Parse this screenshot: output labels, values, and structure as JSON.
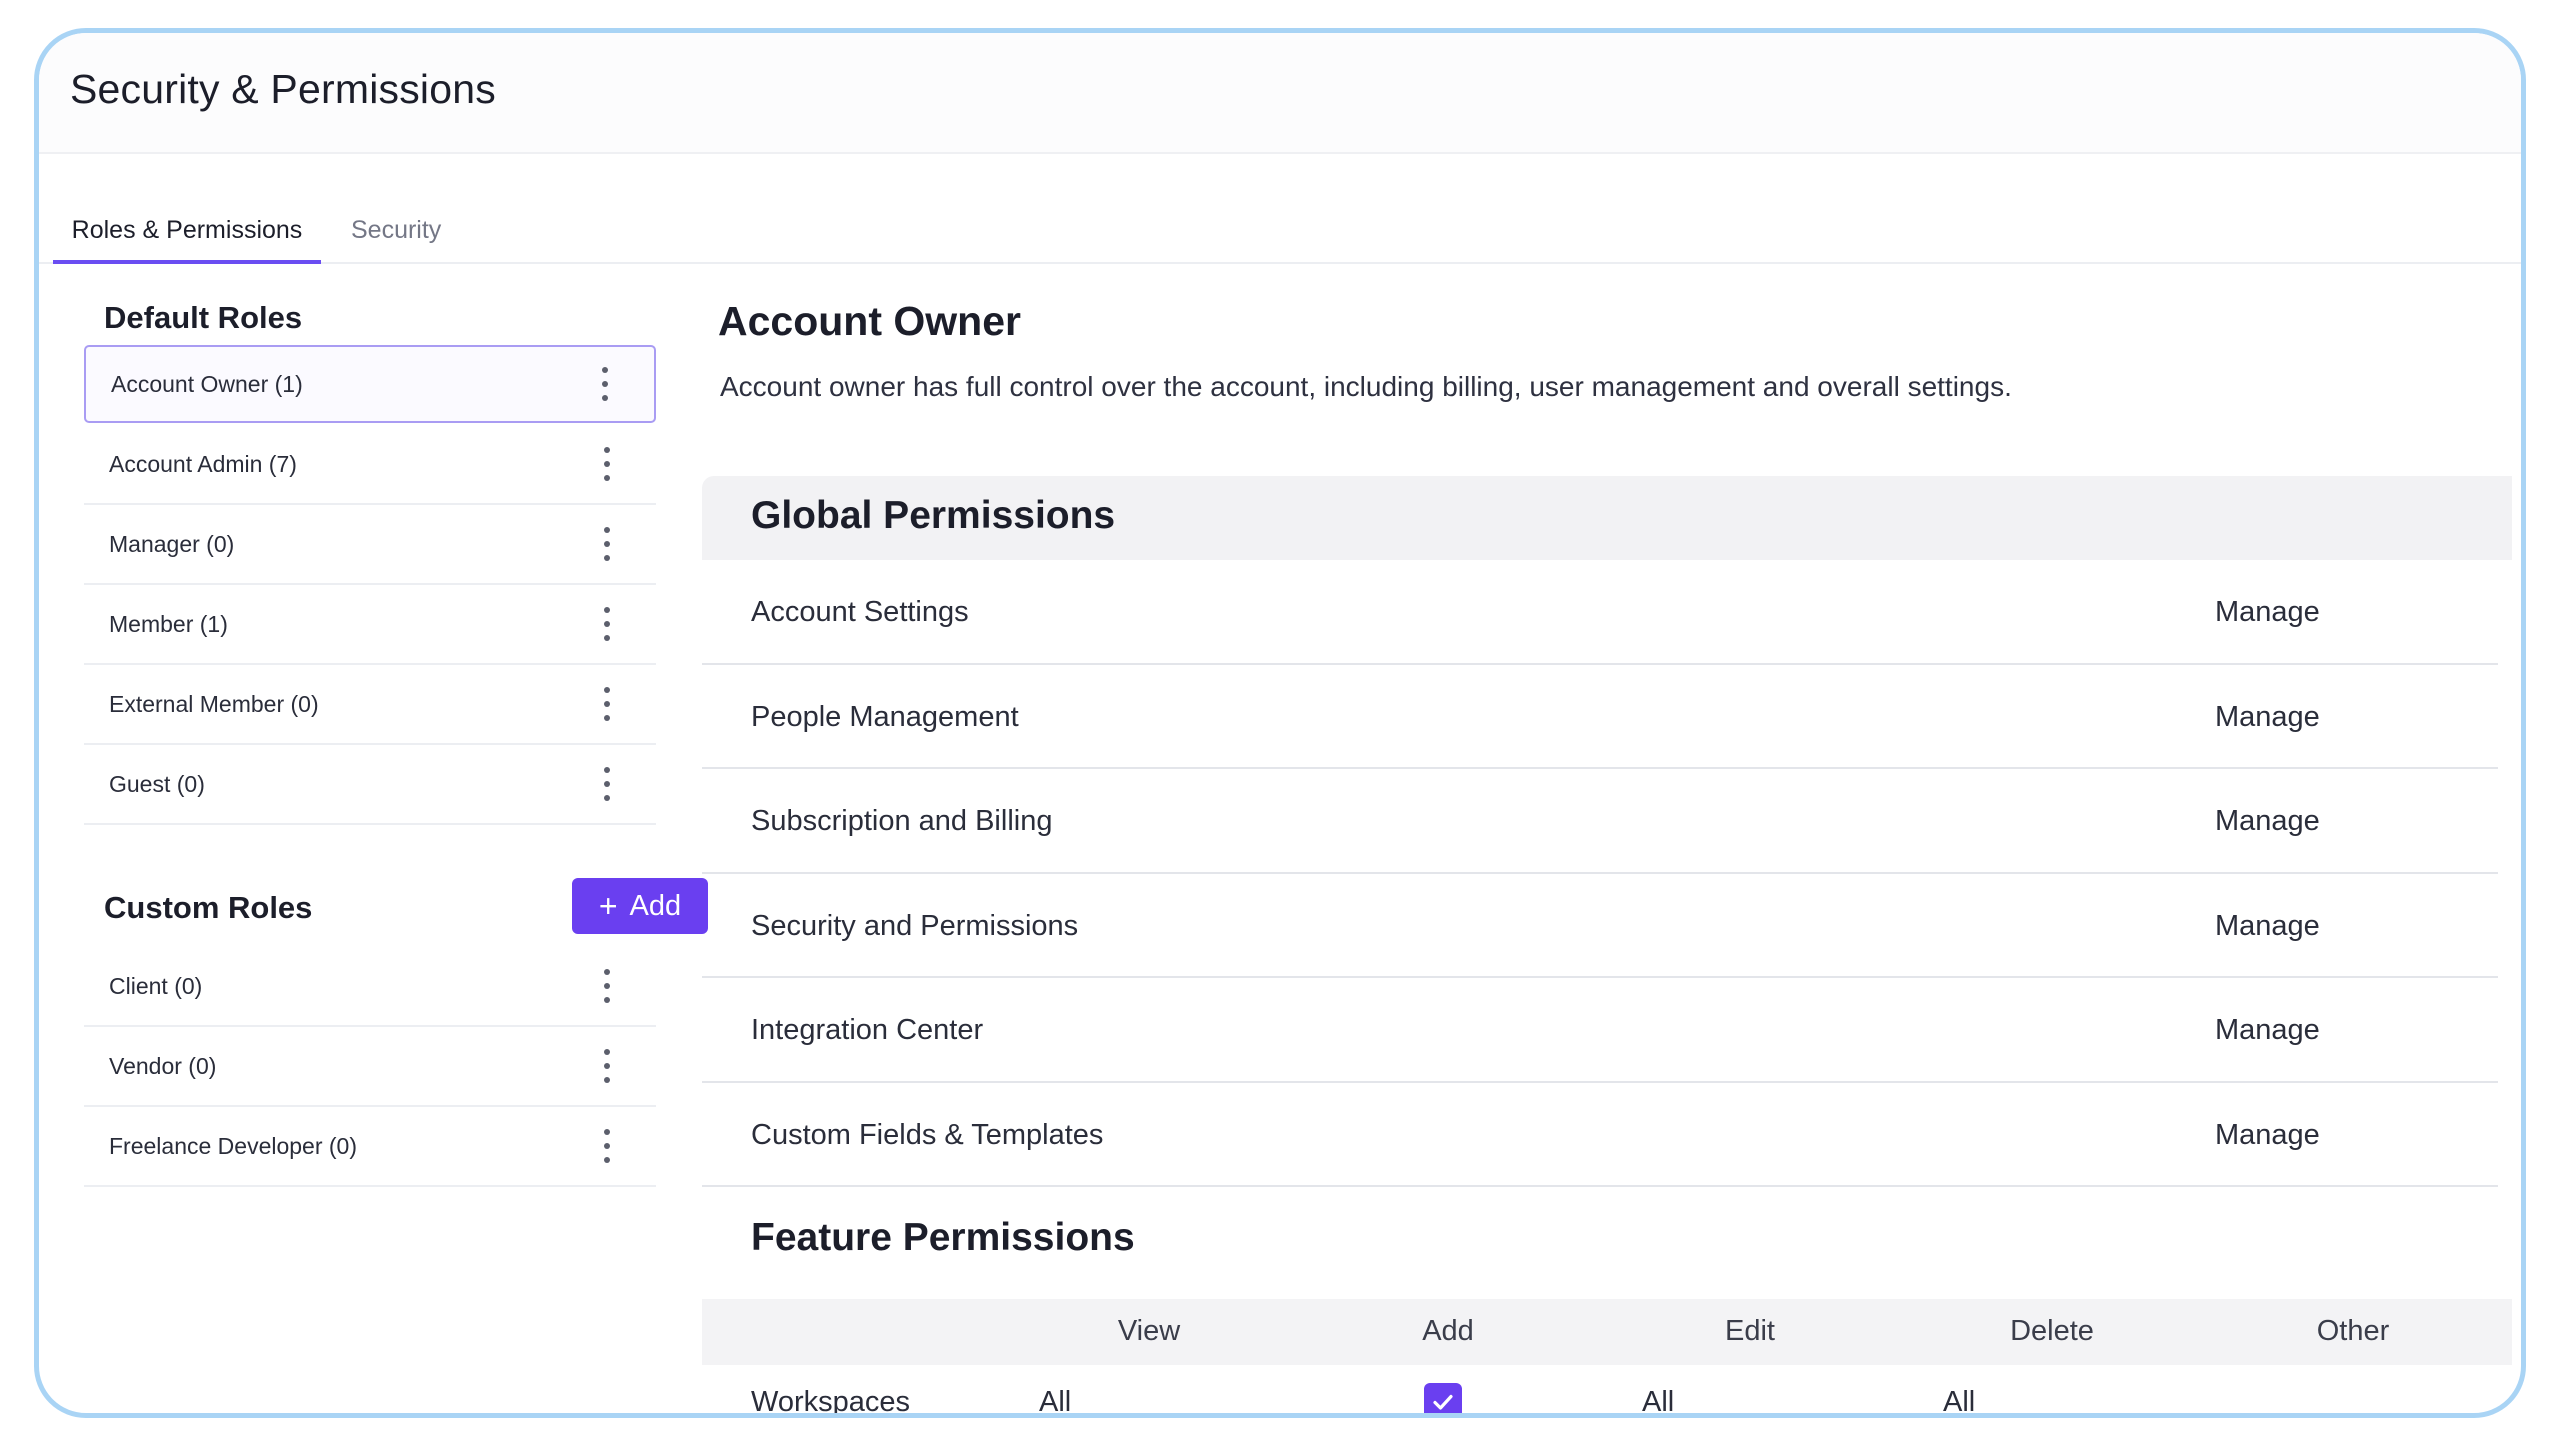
{
  "page": {
    "title": "Security & Permissions"
  },
  "tabs": [
    {
      "label": "Roles & Permissions",
      "active": true
    },
    {
      "label": "Security",
      "active": false
    }
  ],
  "default_roles": {
    "title": "Default Roles",
    "items": [
      {
        "label": "Account Owner (1)",
        "selected": true
      },
      {
        "label": "Account Admin (7)"
      },
      {
        "label": "Manager (0)"
      },
      {
        "label": "Member (1)"
      },
      {
        "label": "External Member (0)"
      },
      {
        "label": "Guest (0)"
      }
    ]
  },
  "custom_roles": {
    "title": "Custom Roles",
    "add_label": "Add",
    "add_icon": "+",
    "items": [
      {
        "label": "Client (0)"
      },
      {
        "label": "Vendor (0)"
      },
      {
        "label": "Freelance Developer (0)"
      }
    ]
  },
  "selected_role": {
    "title": "Account Owner",
    "description": "Account owner has full control over the account, including billing, user management and overall settings."
  },
  "global_permissions": {
    "title": "Global Permissions",
    "rows": [
      {
        "name": "Account Settings",
        "value": "Manage"
      },
      {
        "name": "People Management",
        "value": "Manage"
      },
      {
        "name": "Subscription and Billing",
        "value": "Manage"
      },
      {
        "name": "Security and Permissions",
        "value": "Manage"
      },
      {
        "name": "Integration Center",
        "value": "Manage"
      },
      {
        "name": "Custom Fields & Templates",
        "value": "Manage"
      }
    ]
  },
  "feature_permissions": {
    "title": "Feature Permissions",
    "columns": [
      "View",
      "Add",
      "Edit",
      "Delete",
      "Other"
    ],
    "rows": [
      {
        "name": "Workspaces",
        "view": "All",
        "add": true,
        "edit": "All",
        "delete": "All",
        "other": ""
      }
    ]
  },
  "colors": {
    "accent": "#6a3ff0",
    "frame_border": "#a9d4f5",
    "selected_border": "#a99cf3"
  }
}
